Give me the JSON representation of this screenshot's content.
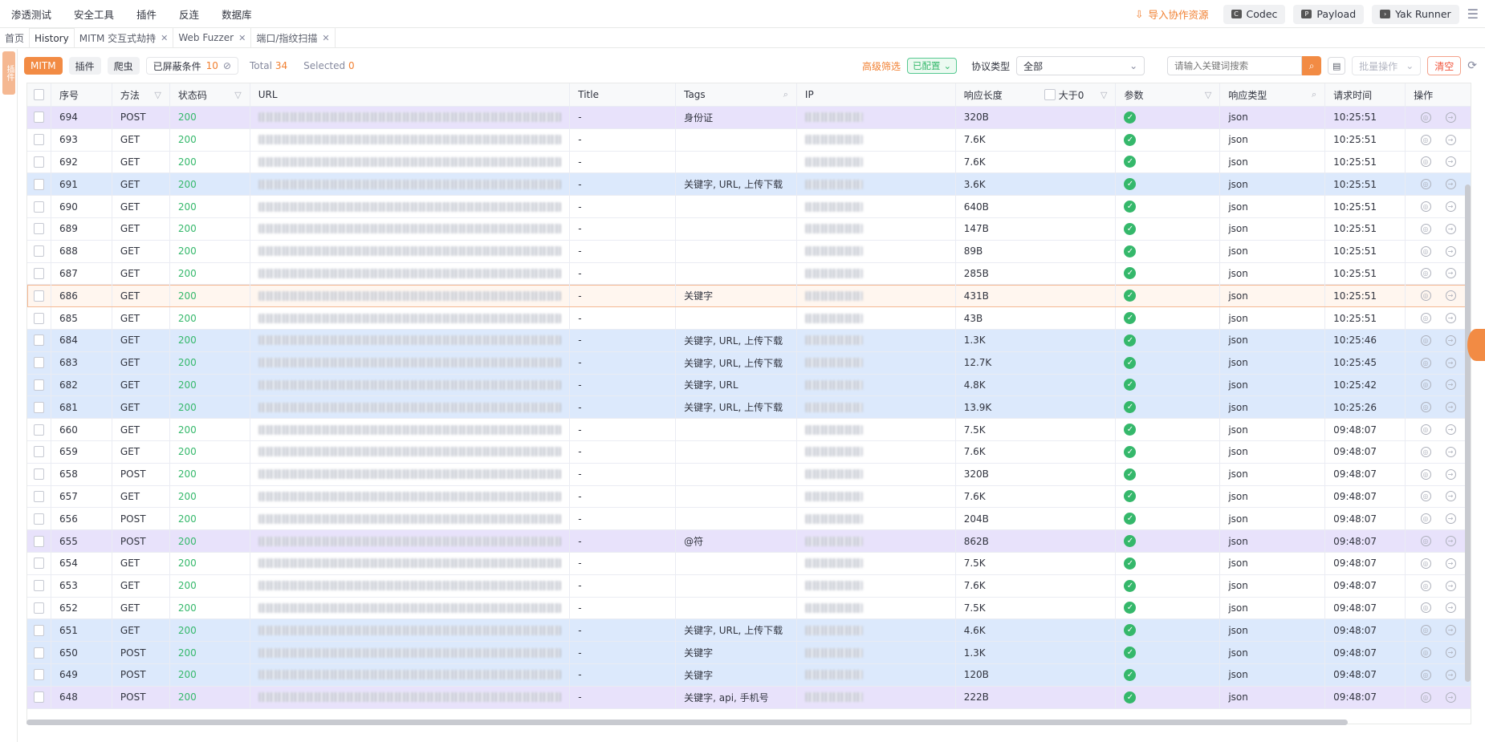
{
  "menubar": {
    "items": [
      "渗透测试",
      "安全工具",
      "插件",
      "反连",
      "数据库"
    ],
    "import_label": "导入协作资源",
    "tools": [
      "Codec",
      "Payload",
      "Yak Runner"
    ]
  },
  "tabs": [
    {
      "label": "首页",
      "closable": false
    },
    {
      "label": "History",
      "closable": false
    },
    {
      "label": "MITM 交互式劫持",
      "closable": true
    },
    {
      "label": "Web Fuzzer",
      "closable": true
    },
    {
      "label": "端口/指纹扫描",
      "closable": true
    }
  ],
  "side_tag": "插件",
  "toolbar": {
    "chips": [
      "MITM",
      "插件",
      "爬虫"
    ],
    "condition_label": "已屏蔽条件",
    "condition_count": "10",
    "total_label": "Total",
    "total_value": "34",
    "selected_label": "Selected",
    "selected_value": "0",
    "adv_filter": "高级筛选",
    "configured": "已配置",
    "proto_label": "协议类型",
    "proto_value": "全部",
    "search_placeholder": "请输入关键词搜索",
    "batch": "批量操作",
    "clear": "清空"
  },
  "columns": [
    "序号",
    "方法",
    "状态码",
    "URL",
    "Title",
    "Tags",
    "IP",
    "响应长度",
    "大于0",
    "参数",
    "响应类型",
    "请求时间",
    "操作"
  ],
  "rows": [
    {
      "id": "694",
      "method": "POST",
      "status": "200",
      "title": "-",
      "tags": "身份证",
      "len": "320B",
      "type": "json",
      "time": "10:25:51",
      "color": "purple"
    },
    {
      "id": "693",
      "method": "GET",
      "status": "200",
      "title": "-",
      "tags": "",
      "len": "7.6K",
      "type": "json",
      "time": "10:25:51",
      "color": ""
    },
    {
      "id": "692",
      "method": "GET",
      "status": "200",
      "title": "-",
      "tags": "",
      "len": "7.6K",
      "type": "json",
      "time": "10:25:51",
      "color": ""
    },
    {
      "id": "691",
      "method": "GET",
      "status": "200",
      "title": "-",
      "tags": "关键字, URL, 上传下载",
      "len": "3.6K",
      "type": "json",
      "time": "10:25:51",
      "color": "blue"
    },
    {
      "id": "690",
      "method": "GET",
      "status": "200",
      "title": "-",
      "tags": "",
      "len": "640B",
      "type": "json",
      "time": "10:25:51",
      "color": ""
    },
    {
      "id": "689",
      "method": "GET",
      "status": "200",
      "title": "-",
      "tags": "",
      "len": "147B",
      "type": "json",
      "time": "10:25:51",
      "color": ""
    },
    {
      "id": "688",
      "method": "GET",
      "status": "200",
      "title": "-",
      "tags": "",
      "len": "89B",
      "type": "json",
      "time": "10:25:51",
      "color": ""
    },
    {
      "id": "687",
      "method": "GET",
      "status": "200",
      "title": "-",
      "tags": "",
      "len": "285B",
      "type": "json",
      "time": "10:25:51",
      "color": ""
    },
    {
      "id": "686",
      "method": "GET",
      "status": "200",
      "title": "-",
      "tags": "关键字",
      "len": "431B",
      "type": "json",
      "time": "10:25:51",
      "color": "sel"
    },
    {
      "id": "685",
      "method": "GET",
      "status": "200",
      "title": "-",
      "tags": "",
      "len": "43B",
      "type": "json",
      "time": "10:25:51",
      "color": ""
    },
    {
      "id": "684",
      "method": "GET",
      "status": "200",
      "title": "-",
      "tags": "关键字, URL, 上传下载",
      "len": "1.3K",
      "type": "json",
      "time": "10:25:46",
      "color": "blue"
    },
    {
      "id": "683",
      "method": "GET",
      "status": "200",
      "title": "-",
      "tags": "关键字, URL, 上传下载",
      "len": "12.7K",
      "type": "json",
      "time": "10:25:45",
      "color": "blue"
    },
    {
      "id": "682",
      "method": "GET",
      "status": "200",
      "title": "-",
      "tags": "关键字, URL",
      "len": "4.8K",
      "type": "json",
      "time": "10:25:42",
      "color": "blue"
    },
    {
      "id": "681",
      "method": "GET",
      "status": "200",
      "title": "-",
      "tags": "关键字, URL, 上传下载",
      "len": "13.9K",
      "type": "json",
      "time": "10:25:26",
      "color": "blue"
    },
    {
      "id": "660",
      "method": "GET",
      "status": "200",
      "title": "-",
      "tags": "",
      "len": "7.5K",
      "type": "json",
      "time": "09:48:07",
      "color": ""
    },
    {
      "id": "659",
      "method": "GET",
      "status": "200",
      "title": "-",
      "tags": "",
      "len": "7.6K",
      "type": "json",
      "time": "09:48:07",
      "color": ""
    },
    {
      "id": "658",
      "method": "POST",
      "status": "200",
      "title": "-",
      "tags": "",
      "len": "320B",
      "type": "json",
      "time": "09:48:07",
      "color": ""
    },
    {
      "id": "657",
      "method": "GET",
      "status": "200",
      "title": "-",
      "tags": "",
      "len": "7.6K",
      "type": "json",
      "time": "09:48:07",
      "color": ""
    },
    {
      "id": "656",
      "method": "POST",
      "status": "200",
      "title": "-",
      "tags": "",
      "len": "204B",
      "type": "json",
      "time": "09:48:07",
      "color": ""
    },
    {
      "id": "655",
      "method": "POST",
      "status": "200",
      "title": "-",
      "tags": "@符",
      "len": "862B",
      "type": "json",
      "time": "09:48:07",
      "color": "purple"
    },
    {
      "id": "654",
      "method": "GET",
      "status": "200",
      "title": "-",
      "tags": "",
      "len": "7.5K",
      "type": "json",
      "time": "09:48:07",
      "color": ""
    },
    {
      "id": "653",
      "method": "GET",
      "status": "200",
      "title": "-",
      "tags": "",
      "len": "7.6K",
      "type": "json",
      "time": "09:48:07",
      "color": ""
    },
    {
      "id": "652",
      "method": "GET",
      "status": "200",
      "title": "-",
      "tags": "",
      "len": "7.5K",
      "type": "json",
      "time": "09:48:07",
      "color": ""
    },
    {
      "id": "651",
      "method": "GET",
      "status": "200",
      "title": "-",
      "tags": "关键字, URL, 上传下载",
      "len": "4.6K",
      "type": "json",
      "time": "09:48:07",
      "color": "blue"
    },
    {
      "id": "650",
      "method": "POST",
      "status": "200",
      "title": "-",
      "tags": "关键字",
      "len": "1.3K",
      "type": "json",
      "time": "09:48:07",
      "color": "blue"
    },
    {
      "id": "649",
      "method": "POST",
      "status": "200",
      "title": "-",
      "tags": "关键字",
      "len": "120B",
      "type": "json",
      "time": "09:48:07",
      "color": "blue"
    },
    {
      "id": "648",
      "method": "POST",
      "status": "200",
      "title": "-",
      "tags": "关键字, api, 手机号",
      "len": "222B",
      "type": "json",
      "time": "09:48:07",
      "color": "purple"
    }
  ]
}
